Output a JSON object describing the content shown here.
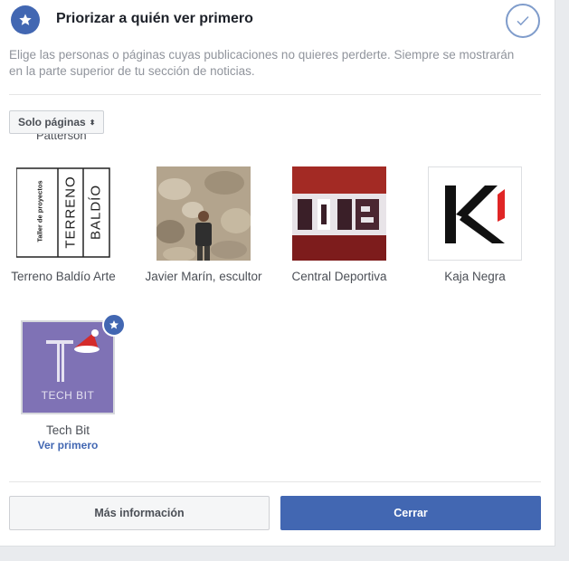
{
  "header": {
    "title": "Priorizar a quién ver primero",
    "badge_icon": "star-icon",
    "done_icon": "check-icon"
  },
  "description": "Elige las personas o páginas cuyas publicaciones no quieres perderte. Siempre se mostrarán en la parte superior de tu sección de noticias.",
  "filter": {
    "label": "Solo páginas",
    "caret": "⬍"
  },
  "partial_name": "Patterson",
  "pages": [
    {
      "name": "Terreno Baldío Arte",
      "logo_small": "Taller de proyectos",
      "logo_a": "TERRENO",
      "logo_b": "BALDÍO"
    },
    {
      "name": "Javier Marín, escultor"
    },
    {
      "name": "Central Deportiva"
    },
    {
      "name": "Kaja Negra"
    },
    {
      "name": "Tech Bit",
      "subtitle": "Ver primero",
      "logo_text": "TECH BIT",
      "selected": true
    }
  ],
  "buttons": {
    "more": "Más información",
    "close": "Cerrar"
  },
  "colors": {
    "accent": "#4267b2",
    "background": "#e9ebee"
  }
}
